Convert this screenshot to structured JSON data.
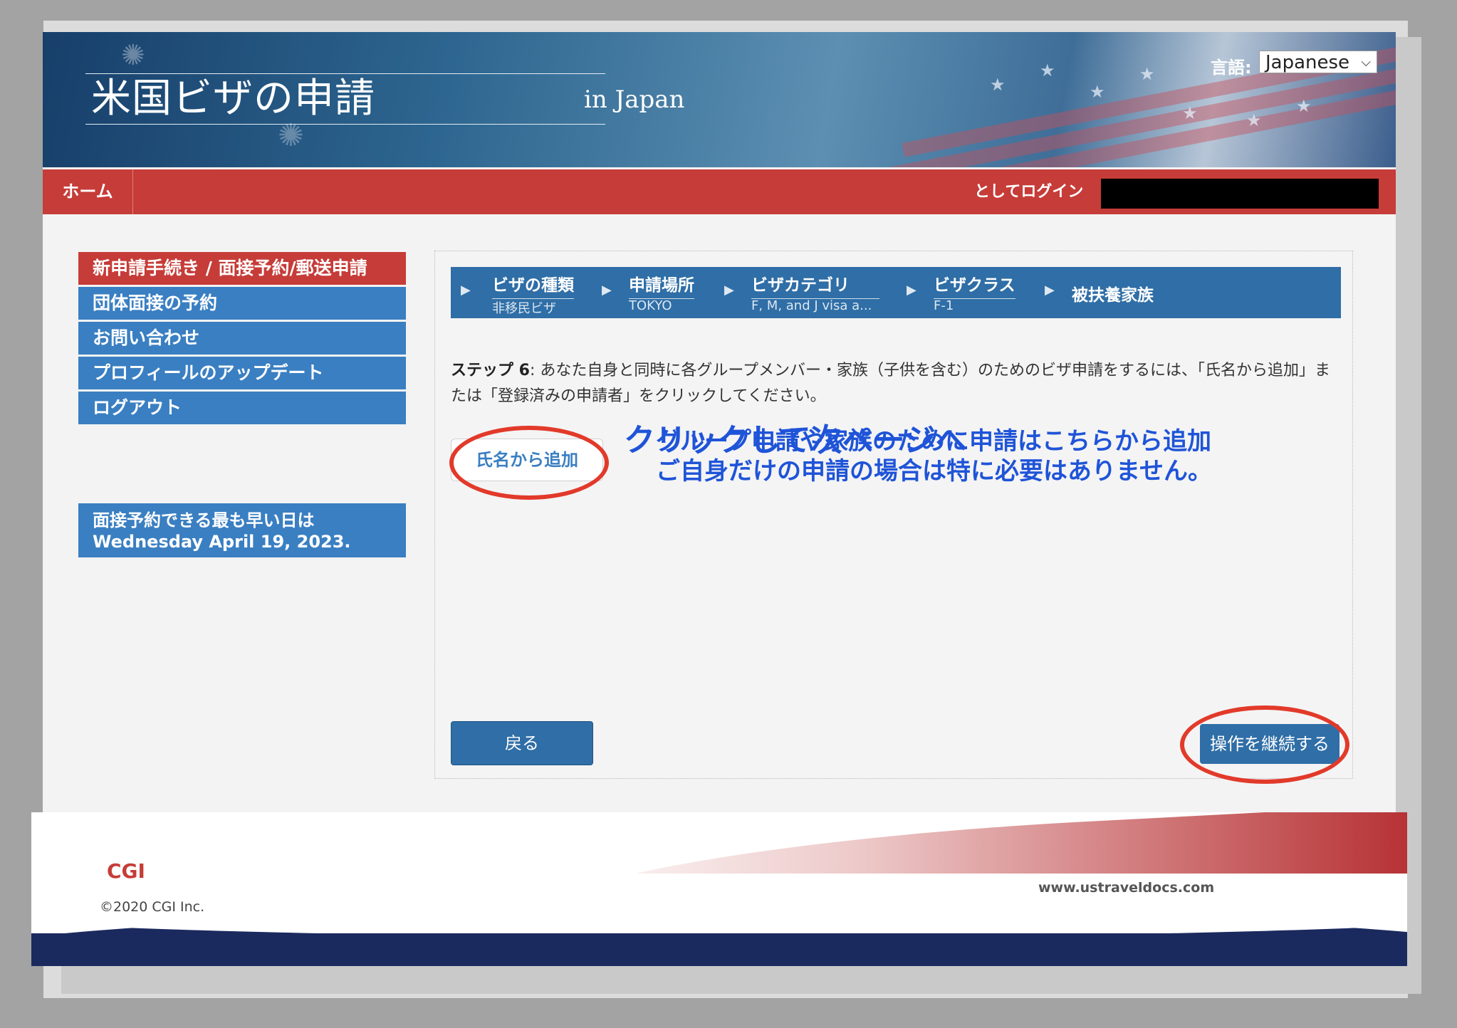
{
  "header": {
    "title": "米国ビザの申請",
    "subtitle": "in  Japan",
    "language_label": "言語:",
    "language_value": "Japanese"
  },
  "nav": {
    "home": "ホーム",
    "login_as": "としてログイン"
  },
  "sidebar": {
    "items": [
      {
        "label": "新申請手続き / 面接予約/郵送申請"
      },
      {
        "label": "団体面接の予約"
      },
      {
        "label": "お問い合わせ"
      },
      {
        "label": "プロフィールのアップデート"
      },
      {
        "label": "ログアウト"
      }
    ],
    "earliest_line1": "面接予約できる最も早い日は",
    "earliest_line2": "Wednesday April 19, 2023."
  },
  "steps": [
    {
      "label": "ビザの種類",
      "value": "非移民ビザ"
    },
    {
      "label": "申請場所",
      "value": "TOKYO"
    },
    {
      "label": "ビザカテゴリ",
      "value": "F, M, and J visa a..."
    },
    {
      "label": "ビザクラス",
      "value": "F-1"
    },
    {
      "label": "被扶養家族",
      "value": ""
    }
  ],
  "instructions": {
    "step_label": "ステップ 6",
    "text": ": あなた自身と同時に各グループメンバー・家族（子供を含む）のためのビザ申請をするには、「氏名から追加」または「登録済みの申請者」をクリックしてください。"
  },
  "buttons": {
    "add_by_name": "氏名から追加",
    "back": "戻る",
    "continue": "操作を継続する"
  },
  "annotations": {
    "note_line1": "グループ申請や家族のために申請はこちらから追加",
    "note_line2": "ご自身だけの申請の場合は特に必要はありません。",
    "next_page": "クリックして次ページへ",
    "accent_color": "#e23a2a",
    "text_color": "#1f54d8"
  },
  "footer": {
    "logo": "CGI",
    "copyright": "©2020 CGI Inc.",
    "website": "www.ustraveldocs.com"
  }
}
